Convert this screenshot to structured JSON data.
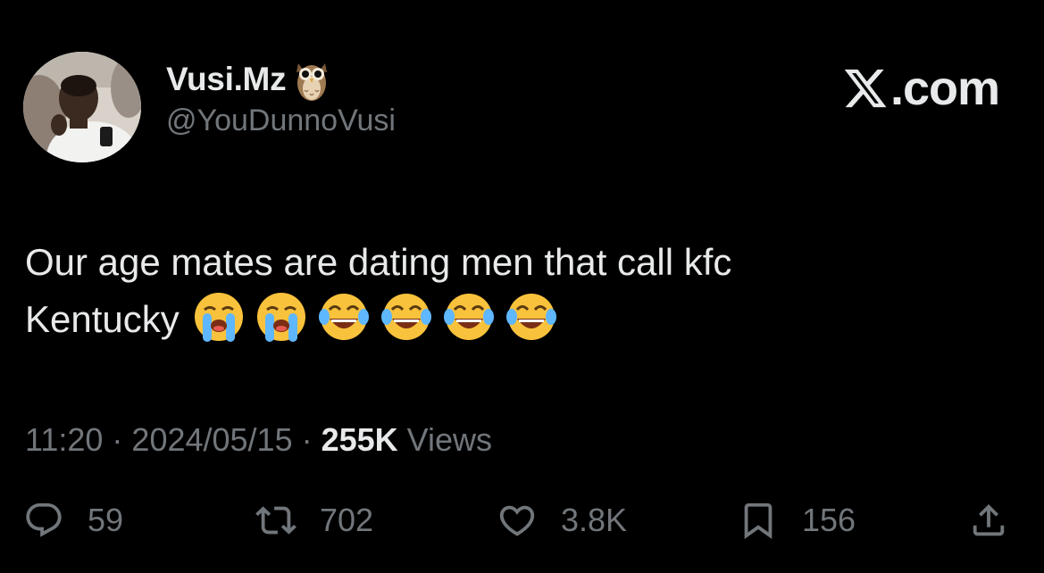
{
  "author": {
    "display_name": "Vusi.Mz",
    "handle": "@YouDunnoVusi"
  },
  "brand": {
    "label": ".com"
  },
  "tweet": {
    "line1": "Our age mates are dating men that call kfc",
    "line2": "Kentucky",
    "emojis": [
      "loudly-crying-face",
      "loudly-crying-face",
      "face-with-tears-of-joy",
      "face-with-tears-of-joy",
      "face-with-tears-of-joy",
      "face-with-tears-of-joy"
    ]
  },
  "meta": {
    "time": "11:20",
    "separator": " · ",
    "date": "2024/05/15",
    "views_count": "255K",
    "views_label": " Views"
  },
  "actions": {
    "replies": "59",
    "reposts": "702",
    "likes": "3.8K",
    "bookmarks": "156"
  },
  "colors": {
    "background": "#000000",
    "primary_text": "#e7e9ea",
    "secondary_text": "#71767b"
  }
}
